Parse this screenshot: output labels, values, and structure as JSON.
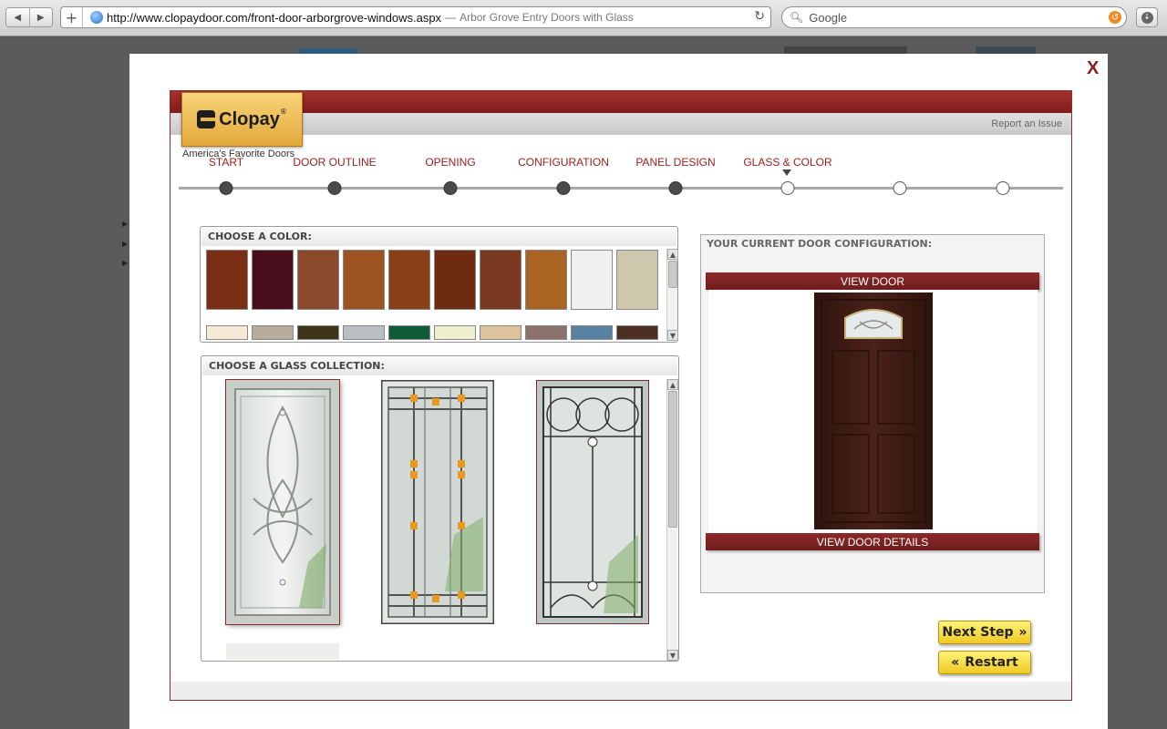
{
  "browser": {
    "url": "http://www.clopaydoor.com/front-door-arborgrove-windows.aspx",
    "page_title": "Arbor Grove Entry Doors with Glass",
    "title_separator": "—",
    "search_placeholder": "Google",
    "back_icon": "back-arrow-icon",
    "forward_icon": "forward-arrow-icon"
  },
  "modal": {
    "close_label": "X",
    "report_label": "Report an Issue",
    "logo_text": "Clopay",
    "logo_tagline": "America's Favorite Doors"
  },
  "steps": [
    {
      "label": "START",
      "state": "done"
    },
    {
      "label": "DOOR OUTLINE",
      "state": "done"
    },
    {
      "label": "OPENING",
      "state": "done"
    },
    {
      "label": "CONFIGURATION",
      "state": "done"
    },
    {
      "label": "PANEL DESIGN",
      "state": "done"
    },
    {
      "label": "GLASS & COLOR",
      "state": "current"
    },
    {
      "label": "",
      "state": "todo"
    },
    {
      "label": "",
      "state": "todo"
    }
  ],
  "colors": {
    "title": "CHOOSE A COLOR:",
    "row1": [
      "#7a2f14",
      "#4a0f1c",
      "#8c4a2c",
      "#9d5222",
      "#8a4017",
      "#6e2b12",
      "#7a3a22",
      "#a86420",
      "#eef0f2",
      "#cfc7ad"
    ],
    "row2": [
      "#f4ead6",
      "#b6ab9c",
      "#3d3318",
      "#b9bec2",
      "#0f5c3a",
      "#eeeecc",
      "#dcc39b",
      "#8b716b",
      "#5880a0",
      "#4d2e22"
    ]
  },
  "glass": {
    "title": "CHOOSE A GLASS COLLECTION:",
    "options": [
      {
        "name": "celtic-glass",
        "selected": true
      },
      {
        "name": "prairie-glass",
        "selected": false
      },
      {
        "name": "arch-glass",
        "selected": false
      }
    ]
  },
  "config": {
    "title": "YOUR CURRENT DOOR CONFIGURATION:",
    "view_door": "VIEW DOOR",
    "view_details": "VIEW DOOR DETAILS",
    "door_color": "#3b1a12"
  },
  "buttons": {
    "next": "Next Step",
    "restart": "Restart"
  },
  "theme": {
    "brand_red": "#8e2a2a",
    "step_text": "#9b1c1c",
    "button_yellow": "#f0c823"
  }
}
